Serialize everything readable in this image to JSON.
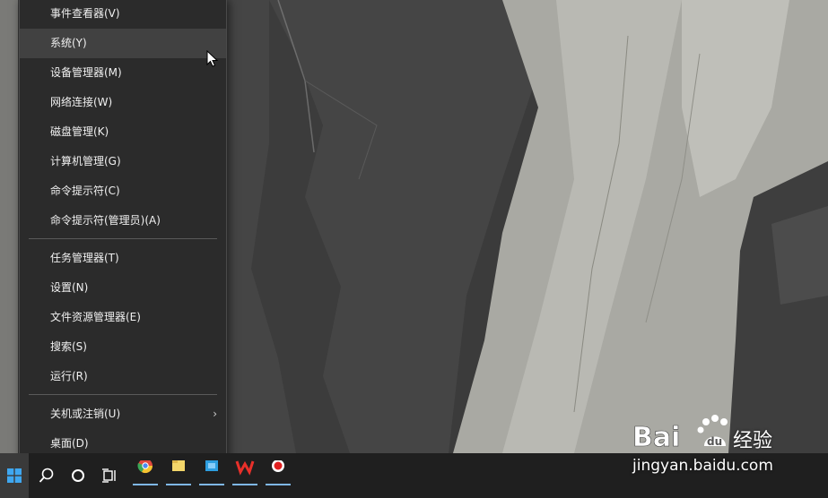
{
  "menu": {
    "items": [
      {
        "label": "事件查看器(V)"
      },
      {
        "label": "系统(Y)"
      },
      {
        "label": "设备管理器(M)"
      },
      {
        "label": "网络连接(W)"
      },
      {
        "label": "磁盘管理(K)"
      },
      {
        "label": "计算机管理(G)"
      },
      {
        "label": "命令提示符(C)"
      },
      {
        "label": "命令提示符(管理员)(A)"
      },
      {
        "label": "任务管理器(T)"
      },
      {
        "label": "设置(N)"
      },
      {
        "label": "文件资源管理器(E)"
      },
      {
        "label": "搜索(S)"
      },
      {
        "label": "运行(R)"
      },
      {
        "label": "关机或注销(U)"
      },
      {
        "label": "桌面(D)"
      }
    ],
    "hovered_item": "系统(Y)",
    "submenu_arrow": "›"
  },
  "watermark": {
    "logo_text": "Baidu",
    "service_text": "经验",
    "url": "jingyan.baidu.com"
  },
  "taskbar": {
    "icons": [
      "windows-start-icon",
      "search-icon",
      "cortana-icon",
      "task-view-icon",
      "chrome-icon",
      "file-explorer-icon",
      "store-icon",
      "wps-icon",
      "screen-recorder-icon"
    ]
  },
  "colors": {
    "menu_bg": "#2b2b2b",
    "menu_hover": "#414141",
    "taskbar_bg": "#1f1f1f",
    "accent": "#7fb7e6"
  }
}
